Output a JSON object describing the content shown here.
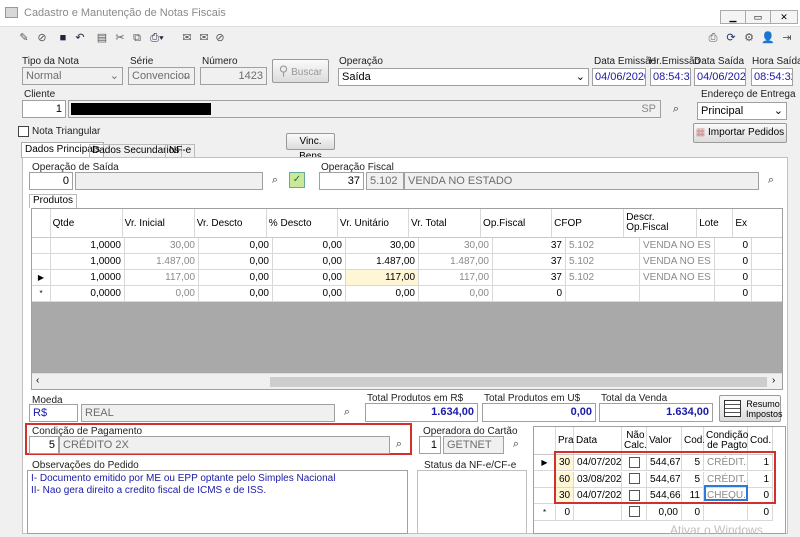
{
  "window": {
    "title": "Cadastro e Manutenção de Notas Fiscais"
  },
  "header": {
    "tipo_label": "Tipo da Nota",
    "tipo_value": "Normal",
    "serie_label": "Série",
    "serie_value": "Convencion",
    "numero_label": "Número",
    "numero_value": "1423",
    "buscar_label": "Buscar",
    "operacao_label": "Operação",
    "operacao_value": "Saída",
    "data_emissao_label": "Data Emissão",
    "data_emissao_value": "04/06/2020",
    "hr_emissao_label": "Hr.Emissão",
    "hr_emissao_value": "08:54:32",
    "data_saida_label": "Data Saída",
    "data_saida_value": "04/06/2020",
    "hora_saida_label": "Hora Saída",
    "hora_saida_value": "08:54:32",
    "cliente_label": "Cliente",
    "cliente_value": "1",
    "cliente_uf": "SP",
    "endereco_label": "Endereço de Entrega",
    "endereco_value": "Principal",
    "nota_triangular_label": "Nota Triangular",
    "importar_label": "Importar Pedidos",
    "vinc_bens_label": "Vinc. Bens"
  },
  "tabs": [
    "Dados Principais",
    "Dados Secundarios",
    "NF-e"
  ],
  "operacao_saida": {
    "label": "Operação de Saída",
    "code": "0",
    "desc": ""
  },
  "operacao_fiscal": {
    "label": "Operação Fiscal",
    "code": "37",
    "cfop": "5.102",
    "desc": "VENDA NO ESTADO"
  },
  "produtos_tab": "Produtos",
  "produtos": {
    "columns": [
      "Qtde",
      "Vr. Inicial",
      "Vr. Descto",
      "% Descto",
      "Vr. Unitário",
      "Vr. Total",
      "Op.Fiscal",
      "CFOP",
      "Descr. Op.Fiscal",
      "Lote",
      "Ex"
    ],
    "rows": [
      {
        "qtde": "1,0000",
        "inicial": "30,00",
        "descto": "0,00",
        "pdescto": "0,00",
        "unit": "30,00",
        "total": "30,00",
        "opf": "37",
        "cfop": "5.102",
        "desc": "VENDA NO ES",
        "lote": "0"
      },
      {
        "qtde": "1,0000",
        "inicial": "1.487,00",
        "descto": "0,00",
        "pdescto": "0,00",
        "unit": "1.487,00",
        "total": "1.487,00",
        "opf": "37",
        "cfop": "5.102",
        "desc": "VENDA NO ES",
        "lote": "0"
      },
      {
        "qtde": "1,0000",
        "inicial": "117,00",
        "descto": "0,00",
        "pdescto": "0,00",
        "unit": "117,00",
        "total": "117,00",
        "opf": "37",
        "cfop": "5.102",
        "desc": "VENDA NO ES",
        "lote": "0"
      },
      {
        "qtde": "0,0000",
        "inicial": "0,00",
        "descto": "0,00",
        "pdescto": "0,00",
        "unit": "0,00",
        "total": "0,00",
        "opf": "0",
        "cfop": "",
        "desc": "",
        "lote": "0"
      }
    ]
  },
  "moeda": {
    "label": "Moeda",
    "code": "R$",
    "desc": "REAL"
  },
  "totais": {
    "prod_rs_label": "Total Produtos em R$",
    "prod_rs": "1.634,00",
    "prod_us_label": "Total Produtos em U$",
    "prod_us": "0,00",
    "venda_label": "Total da Venda",
    "venda": "1.634,00",
    "resumo_label": "Resumo Impostos"
  },
  "pagamento": {
    "label": "Condição de Pagamento",
    "code": "5",
    "desc": "CRÉDITO 2X"
  },
  "operadora": {
    "label": "Operadora do Cartão",
    "code": "1",
    "desc": "GETNET"
  },
  "observacoes": {
    "label": "Observações do Pedido",
    "line1": "I- Documento emitido por ME ou EPP optante pelo Simples Nacional",
    "line2": "II- Nao gera direito a credito fiscal de ICMS e de ISS."
  },
  "status_label": "Status da NF-e/CF-e",
  "parcelas": {
    "columns": [
      "Praz",
      "Data",
      "Não Calc.",
      "Valor",
      "Cod.",
      "Condição de Pagto",
      "Cod."
    ],
    "rows": [
      {
        "praz": "30",
        "data": "04/07/2020",
        "valor": "544,67",
        "cod": "5",
        "cond": "CRÉDIT...",
        "cod2": "1"
      },
      {
        "praz": "60",
        "data": "03/08/2020",
        "valor": "544,67",
        "cod": "5",
        "cond": "CRÉDIT...",
        "cod2": "1"
      },
      {
        "praz": "30",
        "data": "04/07/2020",
        "valor": "544,66",
        "cod": "11",
        "cond": "CHEQU...",
        "cod2": "0"
      },
      {
        "praz": "0",
        "data": "",
        "valor": "0,00",
        "cod": "0",
        "cond": "",
        "cod2": "0"
      }
    ]
  },
  "watermark": "Ativar o Windows"
}
